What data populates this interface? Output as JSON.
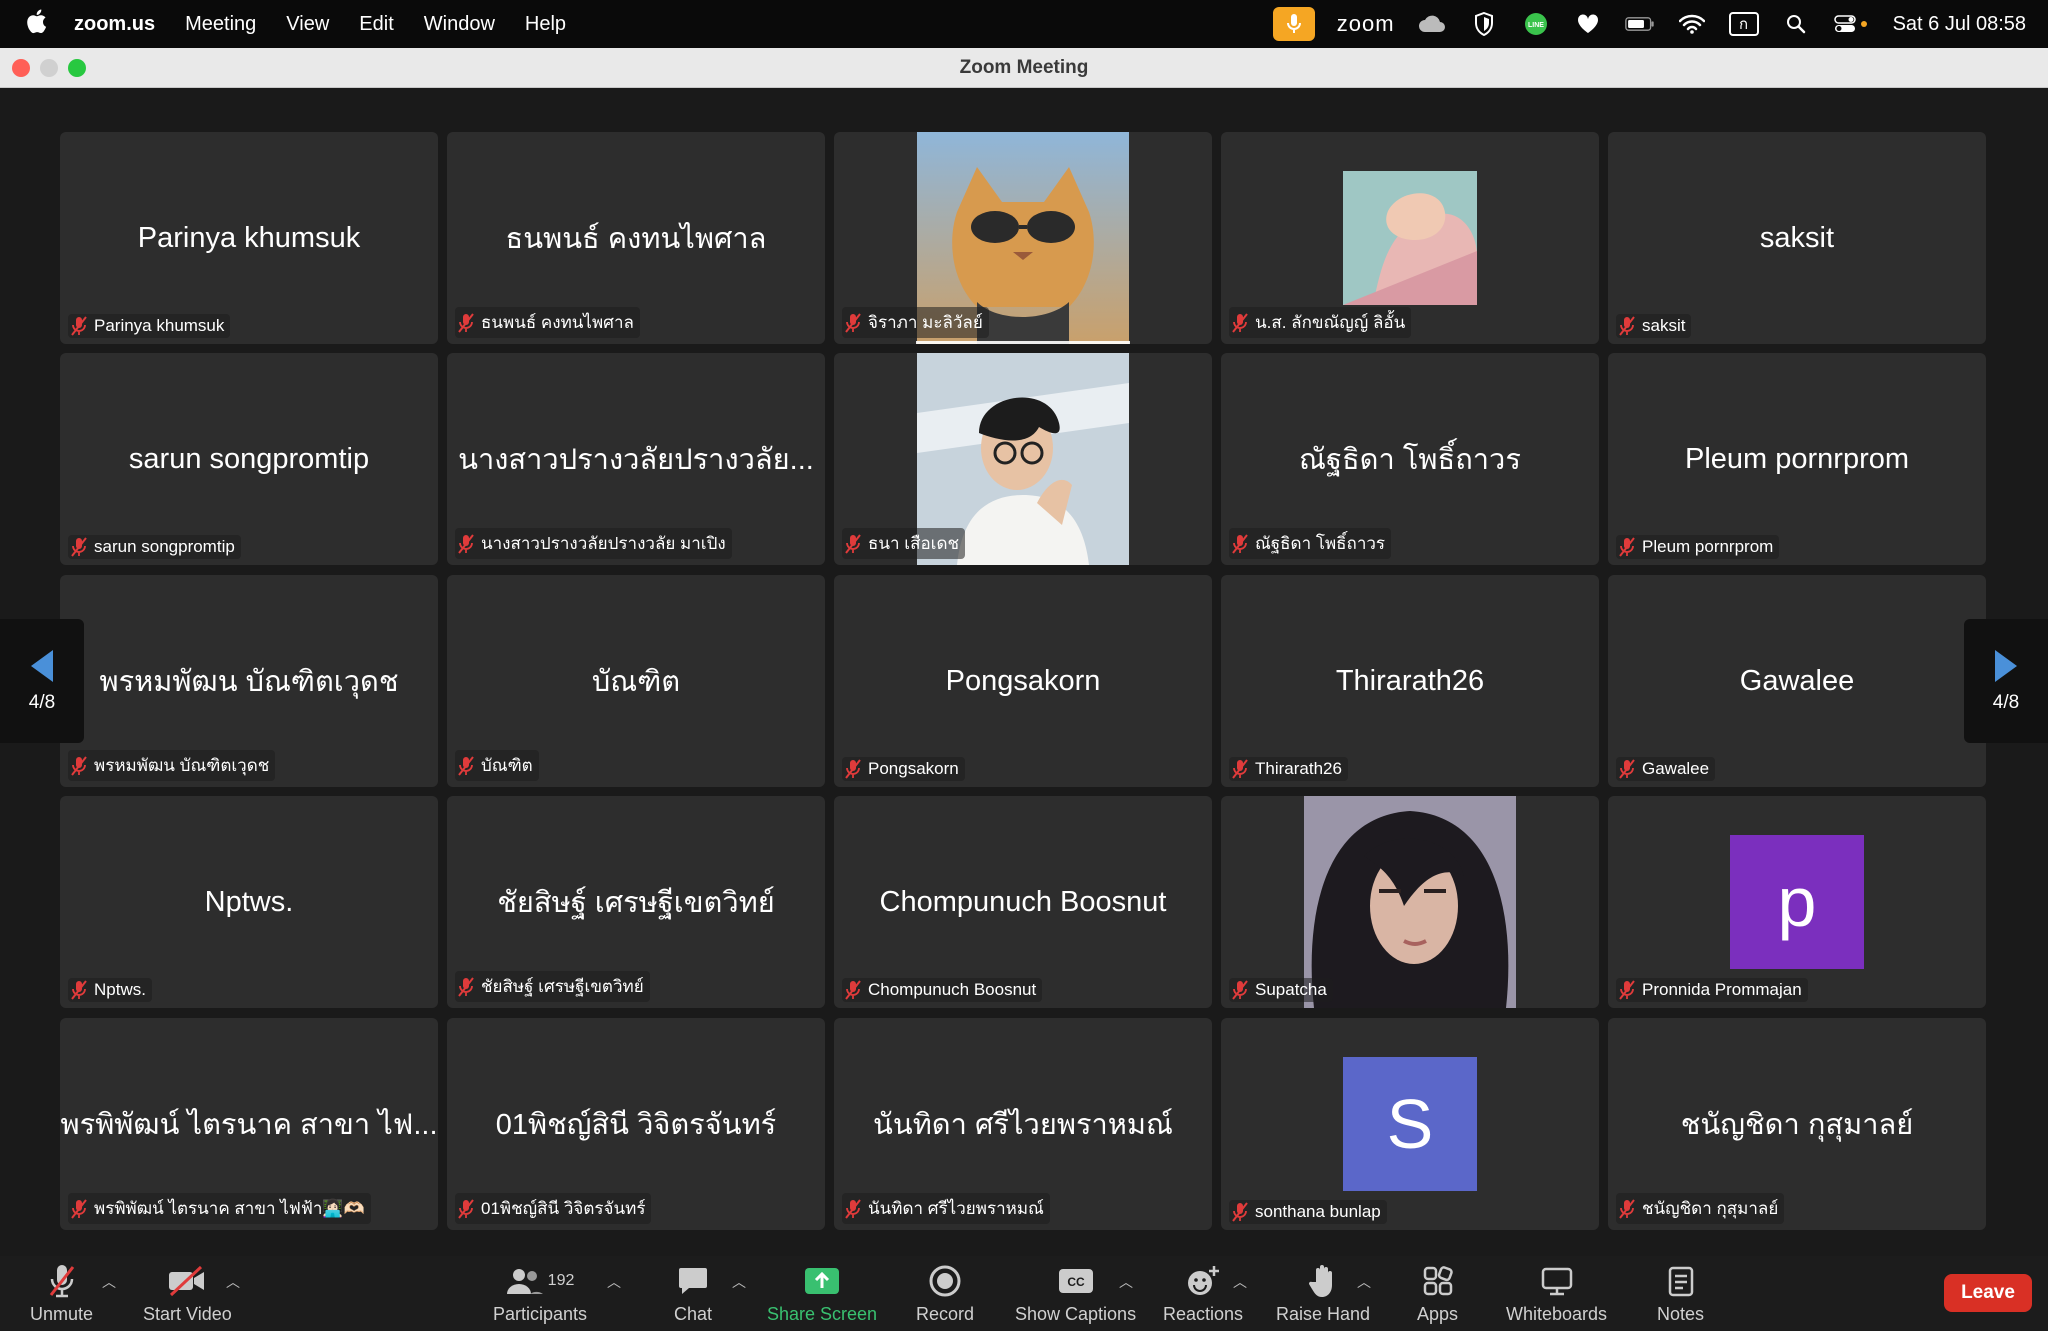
{
  "menubar": {
    "app": "zoom.us",
    "items": [
      "Meeting",
      "View",
      "Edit",
      "Window",
      "Help"
    ],
    "status_app": "zoom",
    "clock": "Sat 6 Jul  08:58",
    "input_indicator": "ก"
  },
  "window": {
    "title": "Zoom Meeting"
  },
  "pager": {
    "left_label": "4/8",
    "right_label": "4/8"
  },
  "tiles": [
    {
      "big": "Parinya khumsuk",
      "label": "Parinya khumsuk"
    },
    {
      "big": "ธนพนธ์ คงทนไพศาล",
      "label": "ธนพนธ์ คงทนไพศาล"
    },
    {
      "big": "",
      "label": "จิราภา มะลิวัลย์",
      "video": "cat-photo"
    },
    {
      "big": "",
      "label": "น.ส. ลักขณัญญ์  ลิอั้น",
      "video": "arm-photo"
    },
    {
      "big": "saksit",
      "label": "saksit"
    },
    {
      "big": "sarun songpromtip",
      "label": "sarun songpromtip"
    },
    {
      "big": "นางสาวปรางวลัยปรางวลัย...",
      "label": "นางสาวปรางวลัยปรางวลัย มาเปิง"
    },
    {
      "big": "",
      "label": "ธนา เสือเดช",
      "video": "person-photo"
    },
    {
      "big": "ณัฐธิดา โพธิ์ถาวร",
      "label": "ณัฐธิดา โพธิ์ถาวร"
    },
    {
      "big": "Pleum pornrprom",
      "label": "Pleum pornrprom"
    },
    {
      "big": "พรหมพัฒน บัณฑิตเวุดช",
      "label": "พรหมพัฒน บัณฑิตเวุดช"
    },
    {
      "big": "บัณฑิต",
      "label": "บัณฑิต"
    },
    {
      "big": "Pongsakorn",
      "label": "Pongsakorn"
    },
    {
      "big": "Thirarath26",
      "label": "Thirarath26"
    },
    {
      "big": "Gawalee",
      "label": "Gawalee"
    },
    {
      "big": "Nptws.",
      "label": "Nptws."
    },
    {
      "big": "ชัยสิษฐ์ เศรษฐีเขตวิทย์",
      "label": "ชัยสิษฐ์ เศรษฐีเขตวิทย์"
    },
    {
      "big": "Chompunuch Boosnut",
      "label": "Chompunuch Boosnut"
    },
    {
      "big": "",
      "label": "Supatcha",
      "video": "woman-photo"
    },
    {
      "big": "",
      "label": "Pronnida Prommajan",
      "avatar": "p",
      "avatar_color": "#7b2fbe"
    },
    {
      "big": "พรพิพัฒน์ ไตรนาค สาขา ไฟ...",
      "label": "พรพิพัฒน์ ไตรนาค สาขา ไฟฟ้า👩🏻‍💻🫶🏻"
    },
    {
      "big": "01พิชญ์สินี วิจิตรจันทร์",
      "label": "01พิชญ์สินี วิจิตรจันทร์"
    },
    {
      "big": "นันทิดา ศรีไวยพราหมณ์",
      "label": "นันทิดา ศรีไวยพราหมณ์"
    },
    {
      "big": "",
      "label": "sonthana bunlap",
      "avatar": "S",
      "avatar_color": "#5b67c9"
    },
    {
      "big": "ชนัญชิดา กุสุมาลย์",
      "label": "ชนัญชิดา กุสุมาลย์"
    }
  ],
  "toolbar": {
    "unmute": "Unmute",
    "start_video": "Start Video",
    "participants": "Participants",
    "participants_count": "192",
    "chat": "Chat",
    "share_screen": "Share Screen",
    "record": "Record",
    "captions": "Show Captions",
    "reactions": "Reactions",
    "raise_hand": "Raise Hand",
    "apps": "Apps",
    "whiteboards": "Whiteboards",
    "notes": "Notes",
    "leave": "Leave"
  },
  "colors": {
    "muted_red": "#e03b3b",
    "leave_red": "#d93025",
    "share_green": "#39c070",
    "mic_badge": "#f5a623"
  }
}
